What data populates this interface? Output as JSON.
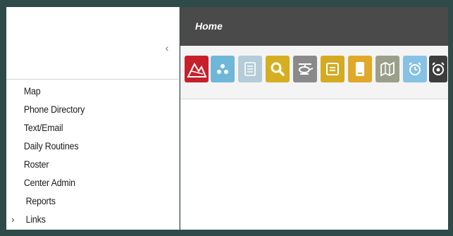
{
  "header": {
    "title": "Home"
  },
  "sidebar": {
    "collapse_glyph": "‹",
    "items": [
      {
        "label": "Map"
      },
      {
        "label": "Phone Directory"
      },
      {
        "label": "Text/Email"
      },
      {
        "label": "Daily Routines"
      },
      {
        "label": "Roster"
      },
      {
        "label": "Center Admin"
      },
      {
        "label": "Reports"
      },
      {
        "label": "Links",
        "chevron": "›"
      }
    ]
  },
  "toolbar": {
    "tools": [
      {
        "icon": "mountain-logo-icon",
        "color": "#c8202a"
      },
      {
        "icon": "dots-cluster-icon",
        "color": "#6fb7d9"
      },
      {
        "icon": "document-icon",
        "color": "#b4ccd8"
      },
      {
        "icon": "search-icon",
        "color": "#d6ae22"
      },
      {
        "icon": "helicopter-icon",
        "color": "#8a8a8a"
      },
      {
        "icon": "message-icon",
        "color": "#d4aa22"
      },
      {
        "icon": "phone-book-icon",
        "color": "#e0a92a"
      },
      {
        "icon": "map-icon",
        "color": "#9a9f8a"
      },
      {
        "icon": "alarm-clock-icon",
        "color": "#87c1e3"
      },
      {
        "icon": "alarm-shield-icon",
        "color": "#3c3c3c"
      }
    ]
  },
  "colors": {
    "frame": "#2f4b49",
    "header_bg": "#4a4a4a",
    "toolbar_bg": "#f4f4f4"
  }
}
